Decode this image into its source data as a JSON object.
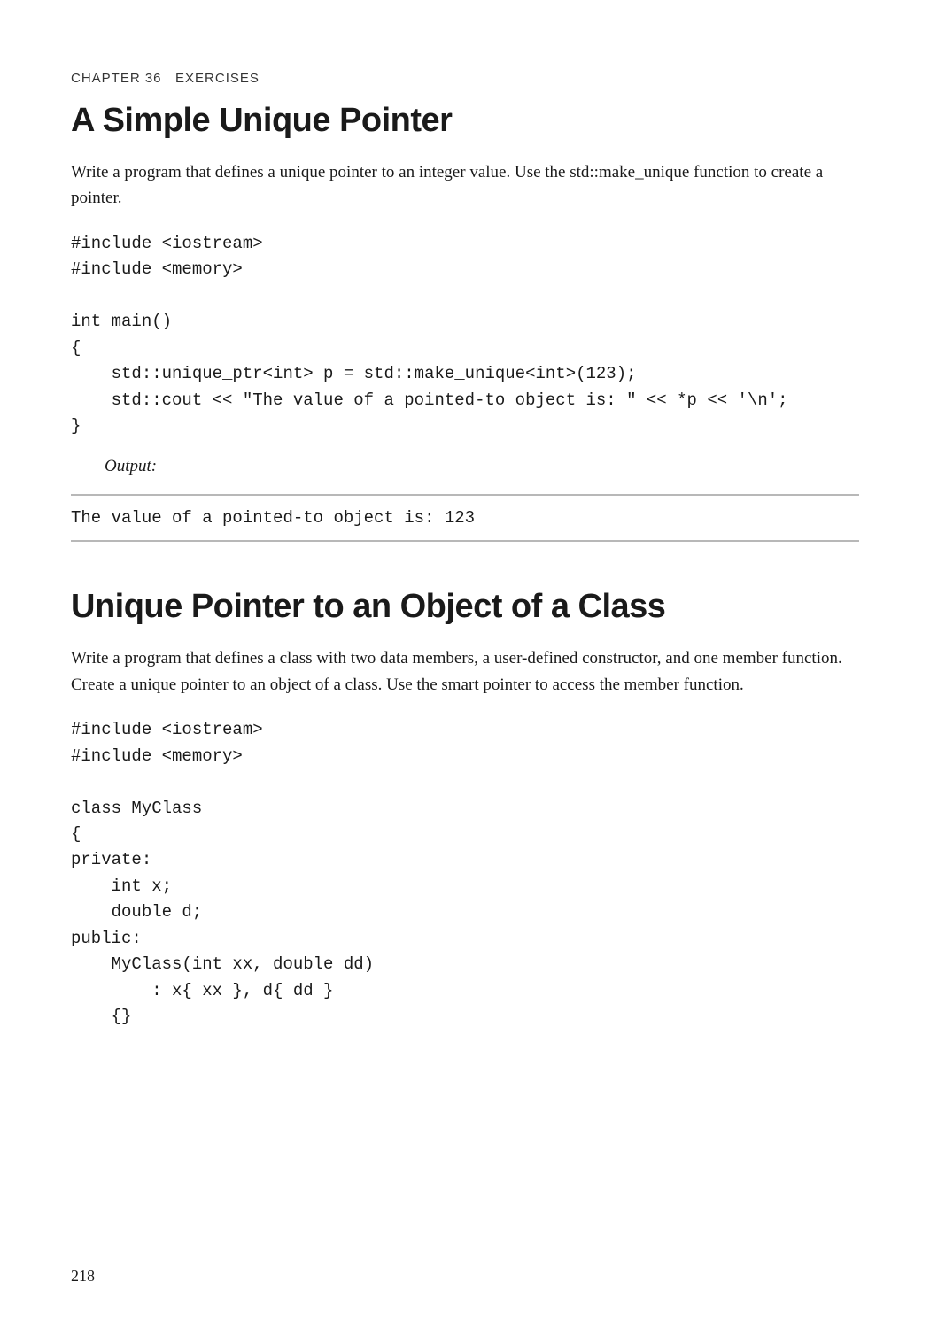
{
  "header": {
    "chapter_label": "Chapter 36",
    "chapter_title": "Exercises"
  },
  "section1": {
    "title": "A Simple Unique Pointer",
    "description": "Write a program that defines a unique pointer to an integer value. Use the std::make_unique function to create a pointer.",
    "code": "#include <iostream>\n#include <memory>\n\nint main()\n{\n    std::unique_ptr<int> p = std::make_unique<int>(123);\n    std::cout << \"The value of a pointed-to object is: \" << *p << '\\n';\n}",
    "output_label": "Output:",
    "output": "The value of a pointed-to object is: 123"
  },
  "section2": {
    "title": "Unique Pointer to an Object of a Class",
    "description": "Write a program that defines a class with two data members, a user-defined constructor, and one member function. Create a unique pointer to an object of a class. Use the smart pointer to access the member function.",
    "code": "#include <iostream>\n#include <memory>\n\nclass MyClass\n{\nprivate:\n    int x;\n    double d;\npublic:\n    MyClass(int xx, double dd)\n        : x{ xx }, d{ dd }\n    {}"
  },
  "page_number": "218"
}
